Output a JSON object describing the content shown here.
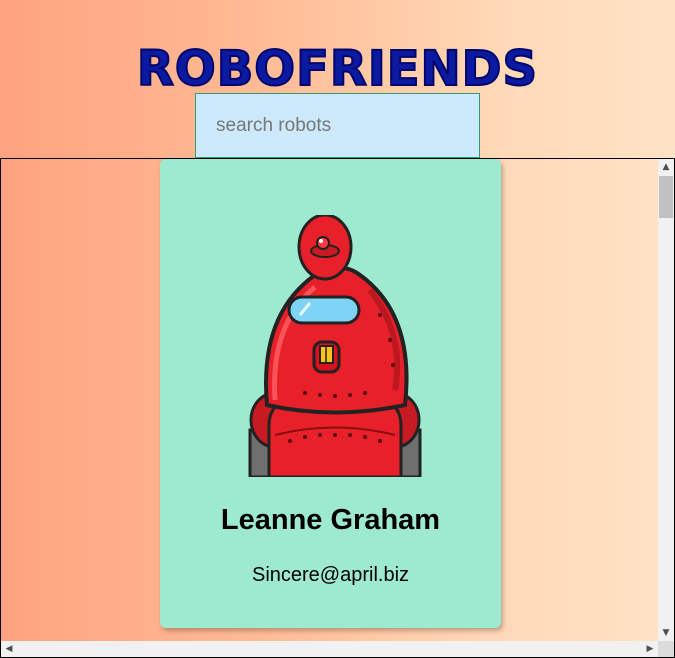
{
  "header": {
    "title": "ROBOFRIENDS"
  },
  "search": {
    "placeholder": "search robots",
    "value": ""
  },
  "robots": [
    {
      "name": "Leanne Graham",
      "email": "Sincere@april.biz"
    }
  ],
  "scrollbar": {
    "up_arrow": "▲",
    "down_arrow": "▼",
    "left_arrow": "◀",
    "right_arrow": "▶"
  },
  "colors": {
    "title": "#0b1aa0",
    "card_background": "#9eead0",
    "search_background": "#cdeafd",
    "robot_body": "#e8202a",
    "robot_visor": "#7fd3f5"
  }
}
